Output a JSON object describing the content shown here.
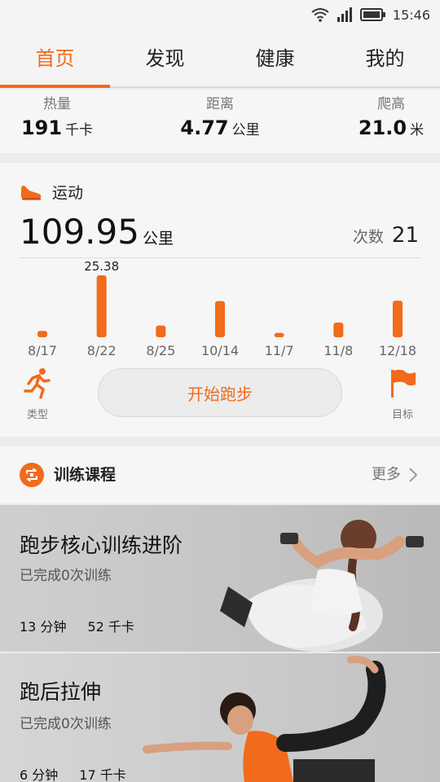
{
  "status_bar": {
    "time": "15:46"
  },
  "tabs": [
    {
      "label": "首页",
      "active": true
    },
    {
      "label": "发现",
      "active": false
    },
    {
      "label": "健康",
      "active": false
    },
    {
      "label": "我的",
      "active": false
    }
  ],
  "stats": {
    "calories": {
      "label": "热量",
      "value": "191",
      "unit": "千卡"
    },
    "distance": {
      "label": "距离",
      "value": "4.77",
      "unit": "公里"
    },
    "climb": {
      "label": "爬高",
      "value": "21.0",
      "unit": "米"
    }
  },
  "exercise": {
    "title": "运动",
    "total_value": "109.95",
    "total_unit": "公里",
    "count_label": "次数",
    "count_value": "21",
    "start_button": "开始跑步",
    "type_label": "类型",
    "goal_label": "目标",
    "type_icon": "runner-icon",
    "goal_icon": "flag-icon"
  },
  "chart_data": {
    "type": "bar",
    "categories": [
      "8/17",
      "8/22",
      "8/25",
      "10/14",
      "11/7",
      "11/8",
      "12/18"
    ],
    "values": [
      2.6,
      25.38,
      4.8,
      14.8,
      1.8,
      6.0,
      15.0
    ],
    "data_labels": [
      null,
      "25.38",
      null,
      null,
      null,
      null,
      null
    ],
    "color": "#f26a1b",
    "ylim": [
      0,
      25.38
    ]
  },
  "training": {
    "title": "训练课程",
    "more_label": "更多",
    "courses": [
      {
        "title": "跑步核心训练进阶",
        "status": "已完成0次训练",
        "duration": "13 分钟",
        "calories": "52 千卡"
      },
      {
        "title": "跑后拉伸",
        "status": "已完成0次训练",
        "duration": "6 分钟",
        "calories": "17 千卡"
      }
    ]
  },
  "colors": {
    "accent": "#f26a1b",
    "background": "#ececec",
    "card": "#f6f6f6"
  }
}
